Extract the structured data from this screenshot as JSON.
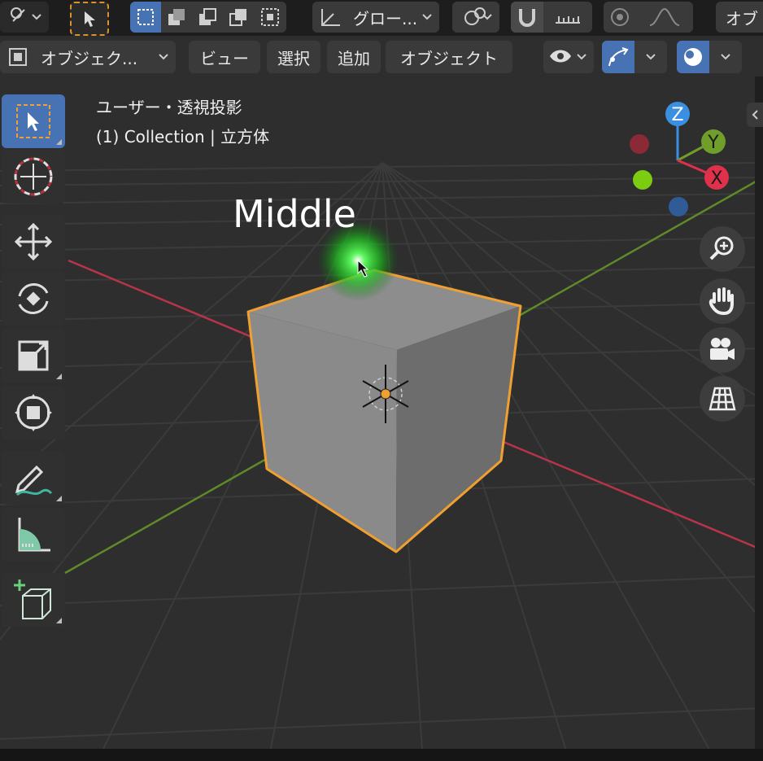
{
  "header": {
    "transform_orientation": "グロー...",
    "top_right_label": "オブ"
  },
  "header2": {
    "mode": "オブジェク...",
    "menus": [
      "ビュー",
      "選択",
      "追加",
      "オブジェクト"
    ]
  },
  "viewport": {
    "view_name": "ユーザー・透視投影",
    "collection_info": "(1) Collection | 立方体",
    "cursor_caption": "Middle"
  },
  "gizmo": {
    "z": "Z",
    "y": "Y",
    "x": "X"
  },
  "colors": {
    "accent": "#4772b3",
    "selection_outline": "#f0a030",
    "axis_x": "#e0304a",
    "axis_y": "#6f9e2b",
    "axis_z": "#3b8fe0",
    "highlight_glow": "#25d025"
  },
  "icons": {
    "left_toolbar": [
      "select-box-icon",
      "cursor-icon",
      "move-icon",
      "rotate-icon",
      "scale-icon",
      "transform-icon",
      "annotate-icon",
      "measure-icon",
      "add-cube-icon"
    ],
    "nav": [
      "zoom-icon",
      "hand-pan-icon",
      "camera-icon",
      "grid-icon"
    ]
  }
}
